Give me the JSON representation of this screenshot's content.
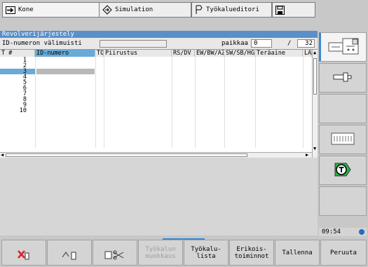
{
  "tabs": [
    {
      "label": "Kone",
      "icon": "arrow-right-icon"
    },
    {
      "label": "Simulation",
      "icon": "diamond-arrow-icon"
    },
    {
      "label": "Työkalueditori",
      "icon": "tool-editor-icon"
    },
    {
      "icon": "floppy-disk-icon"
    }
  ],
  "panel": {
    "title": "Revolverijärjestely",
    "memory_label": "ID-numeron välimuisti",
    "memory_value": "",
    "place_label": "paikkaa",
    "place_value": "0",
    "separator": "/",
    "place_total": "32"
  },
  "table": {
    "columns": [
      "T #",
      "ID-numero",
      "TO",
      "Piirustus",
      "RS/DV",
      "EW/BW/AZ",
      "SW/SB/HG",
      "Teräaine",
      "LA"
    ],
    "rows": [
      "1",
      "2",
      "3",
      "4",
      "5",
      "6",
      "7",
      "8",
      "9",
      "10"
    ],
    "selected_row": 3
  },
  "side": {
    "clock": "09:54"
  },
  "bottom": {
    "soft_keys": [
      {
        "label": "",
        "icon": "delete-tool-icon"
      },
      {
        "label": "",
        "icon": "load-tool-icon"
      },
      {
        "label": "",
        "icon": "cut-tool-icon"
      },
      {
        "label": "Työkalun\nmuokkaus",
        "disabled": true
      },
      {
        "label": "Työkalu-\nlista"
      },
      {
        "label": "Erikois-\ntoiminnot"
      },
      {
        "label": "Tallenna"
      },
      {
        "label": "Peruuta"
      }
    ]
  },
  "colors": {
    "title_bar": "#5a8fc8",
    "selected_cell": "#6aaad8",
    "accent": "#3a8ad0"
  }
}
